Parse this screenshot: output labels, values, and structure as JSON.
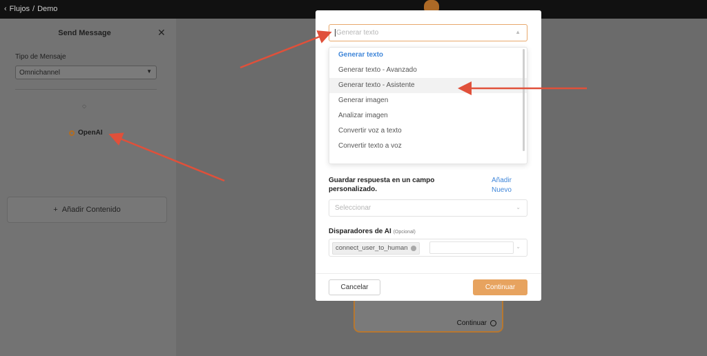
{
  "topbar": {
    "back_label": "Flujos",
    "separator": "/",
    "current": "Demo"
  },
  "side_panel": {
    "title": "Send Message",
    "message_type_label": "Tipo de Mensaje",
    "message_type_value": "Omnichannel",
    "service_label": "OpenAI",
    "add_content_label": "Añadir Contenido"
  },
  "node": {
    "continue_label": "Continuar"
  },
  "modal": {
    "search_placeholder": "Generar texto",
    "options": [
      "Generar texto",
      "Generar texto - Avanzado",
      "Generar texto - Asistente",
      "Generar imagen",
      "Analizar imagen",
      "Convertir voz a texto",
      "Convertir texto a voz"
    ],
    "selected_option": "Generar texto",
    "hovered_option": "Generar texto - Asistente",
    "save_response_label": "Guardar respuesta en un campo personalizado.",
    "add_new_label": "Añadir Nuevo",
    "select_placeholder": "Seleccionar",
    "triggers_label": "Disparadores de AI",
    "triggers_optional": "(Opcional)",
    "trigger_tag": "connect_user_to_human",
    "cancel_label": "Cancelar",
    "continue_label": "Continuar"
  },
  "colors": {
    "accent": "#e7a35f",
    "link": "#3f86d9",
    "arrow": "#e0503a",
    "focus_border": "#e8a86b"
  }
}
